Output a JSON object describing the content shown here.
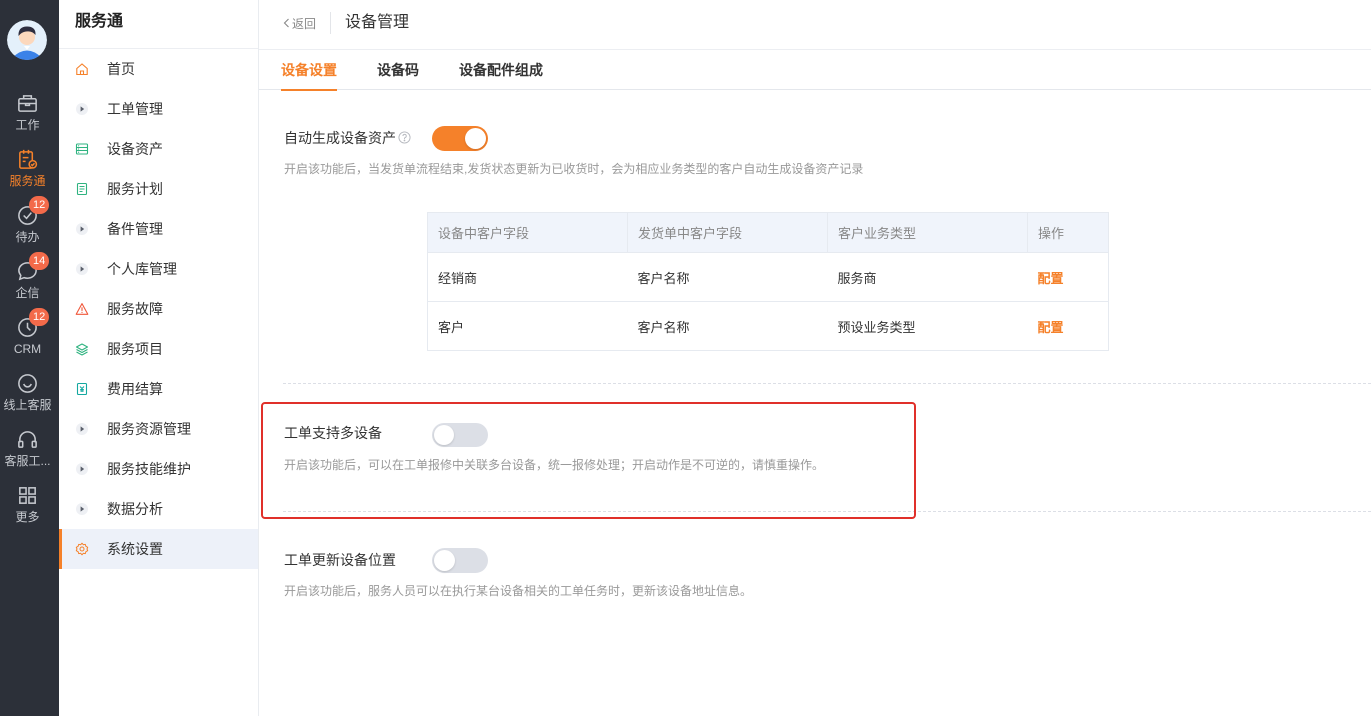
{
  "rail": {
    "items": [
      {
        "label": "工作",
        "icon": "briefcase-icon"
      },
      {
        "label": "服务通",
        "icon": "service-clipboard-icon",
        "active": true
      },
      {
        "label": "待办",
        "icon": "check-circle-icon",
        "badge": "12"
      },
      {
        "label": "企信",
        "icon": "chat-bubble-icon",
        "badge": "14"
      },
      {
        "label": "CRM",
        "icon": "clock-icon",
        "badge": "12"
      },
      {
        "label": "线上客服",
        "icon": "smile-icon"
      },
      {
        "label": "客服工...",
        "icon": "headset-icon"
      },
      {
        "label": "更多",
        "icon": "grid-icon"
      }
    ]
  },
  "sidebar": {
    "title": "服务通",
    "items": [
      {
        "label": "首页",
        "icon": "home-icon"
      },
      {
        "label": "工单管理",
        "icon": "caret-right-icon"
      },
      {
        "label": "设备资产",
        "icon": "device-asset-icon"
      },
      {
        "label": "服务计划",
        "icon": "document-icon"
      },
      {
        "label": "备件管理",
        "icon": "caret-right-icon"
      },
      {
        "label": "个人库管理",
        "icon": "caret-right-icon"
      },
      {
        "label": "服务故障",
        "icon": "warning-icon"
      },
      {
        "label": "服务项目",
        "icon": "layers-icon"
      },
      {
        "label": "费用结算",
        "icon": "invoice-icon"
      },
      {
        "label": "服务资源管理",
        "icon": "caret-right-icon"
      },
      {
        "label": "服务技能维护",
        "icon": "caret-right-icon"
      },
      {
        "label": "数据分析",
        "icon": "caret-right-icon"
      },
      {
        "label": "系统设置",
        "icon": "gear-icon",
        "active": true
      }
    ]
  },
  "header": {
    "back_label": "返回",
    "title": "设备管理"
  },
  "tabs": [
    {
      "label": "设备设置",
      "active": true
    },
    {
      "label": "设备码",
      "active": false
    },
    {
      "label": "设备配件组成",
      "active": false
    }
  ],
  "settings": [
    {
      "label": "自动生成设备资产",
      "enabled": true,
      "description": "开启该功能后，当发货单流程结束,发货状态更新为已收货时，会为相应业务类型的客户自动生成设备资产记录"
    },
    {
      "label": "工单支持多设备",
      "enabled": false,
      "description": "开启该功能后，可以在工单报修中关联多台设备，统一报修处理；开启动作是不可逆的，请慎重操作。"
    },
    {
      "label": "工单更新设备位置",
      "enabled": false,
      "description": "开启该功能后，服务人员可以在执行某台设备相关的工单任务时，更新该设备地址信息。"
    }
  ],
  "mapping_table": {
    "columns": [
      "设备中客户字段",
      "发货单中客户字段",
      "客户业务类型",
      "操作"
    ],
    "rows": [
      [
        "经销商",
        "客户名称",
        "服务商",
        "配置"
      ],
      [
        "客户",
        "客户名称",
        "预设业务类型",
        "配置"
      ]
    ]
  },
  "colors": {
    "accent": "#f5812a",
    "rail_bg": "#2c3039",
    "highlight": "#e0302a",
    "toggle_off": "#dcdfe6"
  }
}
